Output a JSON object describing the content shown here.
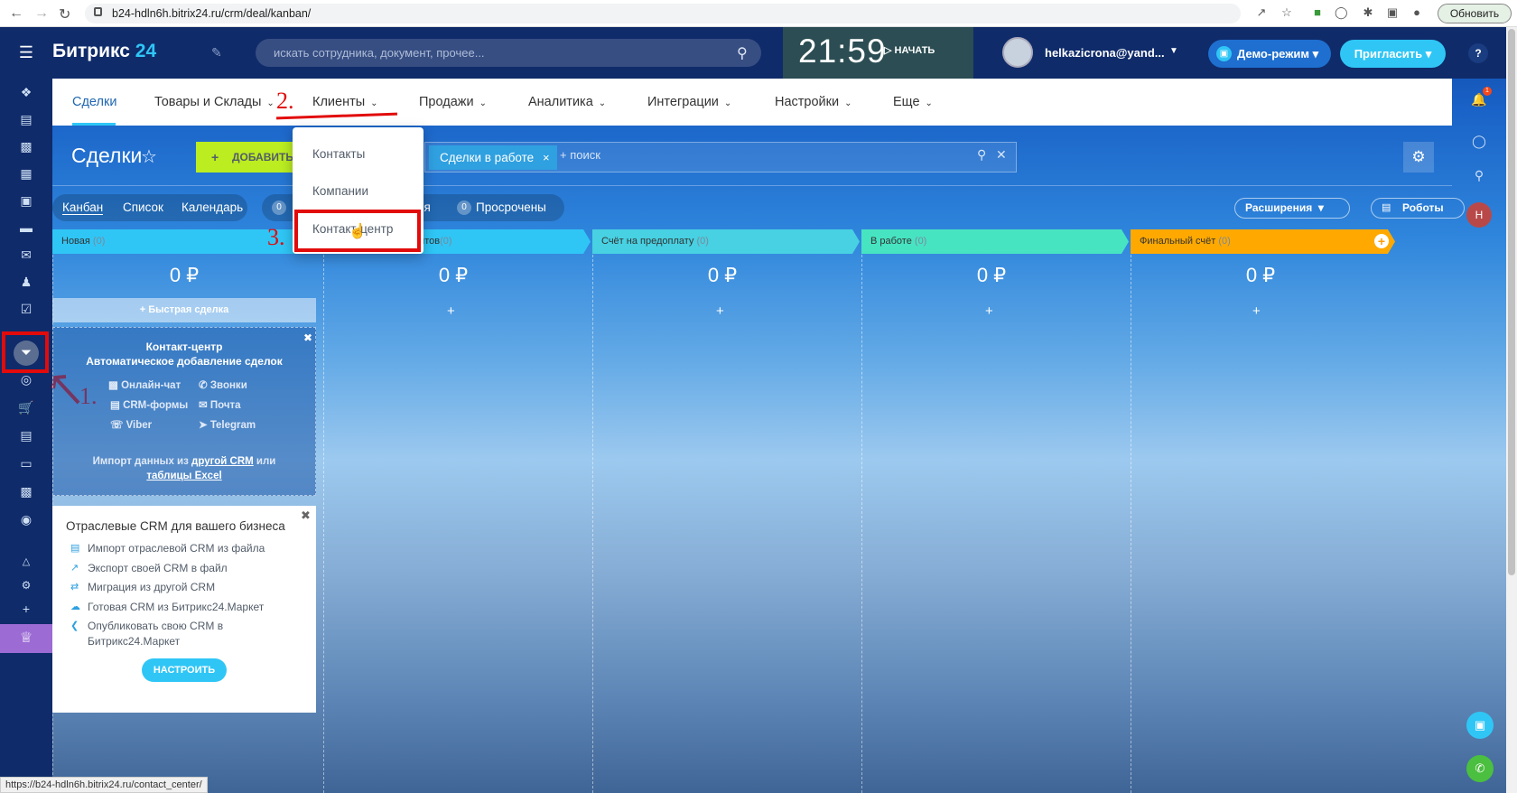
{
  "browser": {
    "url": "b24-hdln6h.bitrix24.ru/crm/deal/kanban/",
    "refresh_label": "Обновить"
  },
  "header": {
    "logo_main": "Битрикс",
    "logo_num": "24",
    "search_placeholder": "искать сотрудника, документ, прочее...",
    "clock": "21:59",
    "start_label": "НАЧАТЬ",
    "user": "helkazicrona@yand...",
    "demo_label": "Демо-режим",
    "invite_label": "Пригласить",
    "help": "?"
  },
  "menu": {
    "items": [
      "Сделки",
      "Товары и Склады",
      "Клиенты",
      "Продажи",
      "Аналитика",
      "Интеграции",
      "Настройки",
      "Еще"
    ],
    "active": "Сделки"
  },
  "dropdown": {
    "items": [
      "Контакты",
      "Компании",
      "Контакт-центр"
    ]
  },
  "annotations": {
    "step1": "1.",
    "step2": "2.",
    "step3": "3."
  },
  "page": {
    "title": "Сделки",
    "add_button": "ДОБАВИТЬ",
    "filter_tag": "Сделки в работе",
    "filter_placeholder": "+ поиск",
    "views": [
      "Канбан",
      "Список",
      "Календарь"
    ],
    "counter1_value": "0",
    "counter1_label": "ня",
    "counter2_value": "0",
    "counter2_label": "Просрочены",
    "extensions": "Расширения",
    "robots": "Роботы"
  },
  "kanban": {
    "columns": [
      {
        "name": "Новая",
        "count": "(0)",
        "sum": "0 ₽",
        "color": "#2fc6f6"
      },
      {
        "name": "ентов",
        "count": "(0)",
        "sum": "0 ₽",
        "color": "#2fc6f6"
      },
      {
        "name": "Счёт на предоплату",
        "count": "(0)",
        "sum": "0 ₽",
        "color": "#47d1e2"
      },
      {
        "name": "В работе",
        "count": "(0)",
        "sum": "0 ₽",
        "color": "#47e4c2"
      },
      {
        "name": "Финальный счёт",
        "count": "(0)",
        "sum": "0 ₽",
        "color": "#ffa900"
      }
    ],
    "quick_deal": "+ Быстрая сделка"
  },
  "contact_center_panel": {
    "title": "Контакт-центр",
    "subtitle": "Автоматическое добавление сделок",
    "channels": [
      "Онлайн-чат",
      "Звонки",
      "CRM-формы",
      "Почта",
      "Viber",
      "Telegram"
    ],
    "import_text_1": "Импорт данных из ",
    "import_link_1": "другой CRM",
    "import_text_2": " или",
    "import_link_2": "таблицы Excel"
  },
  "crm_panel": {
    "title": "Отраслевые CRM для вашего бизнеса",
    "items": [
      "Импорт отраслевой CRM из файла",
      "Экспорт своей CRM в файл",
      "Миграция из другой CRM",
      "Готовая CRM из Битрикс24.Маркет",
      "Опубликовать свою CRM в",
      "Битрикс24.Маркет"
    ],
    "button": "НАСТРОИТЬ"
  },
  "status_url": "https://b24-hdln6h.bitrix24.ru/contact_center/",
  "colors": {
    "accent": "#2fc6f6",
    "sidebar": "#0f2b6a",
    "add_button": "#bbed21",
    "highlight_red": "#e20b0b"
  }
}
